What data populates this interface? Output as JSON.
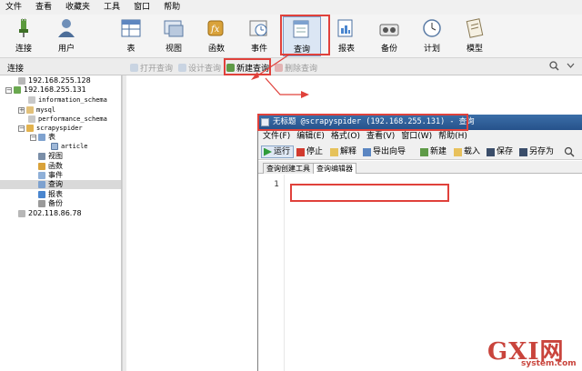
{
  "menubar": [
    "文件",
    "查看",
    "收藏夹",
    "工具",
    "窗口",
    "帮助"
  ],
  "toolbar": [
    {
      "label": "连接",
      "icon": "plug-connection-icon"
    },
    {
      "label": "用户",
      "icon": "user-icon"
    },
    {
      "label": "表",
      "icon": "table-icon"
    },
    {
      "label": "视图",
      "icon": "view-icon"
    },
    {
      "label": "函数",
      "icon": "function-icon"
    },
    {
      "label": "事件",
      "icon": "event-clock-icon"
    },
    {
      "label": "查询",
      "icon": "query-icon"
    },
    {
      "label": "报表",
      "icon": "report-icon"
    },
    {
      "label": "备份",
      "icon": "backup-icon"
    },
    {
      "label": "计划",
      "icon": "schedule-icon"
    },
    {
      "label": "模型",
      "icon": "model-icon"
    }
  ],
  "subbar": {
    "connection_label": "连接",
    "open_query": "打开查询",
    "design_query": "设计查询",
    "new_query": "新建查询",
    "delete_query": "删除查询"
  },
  "tree": [
    {
      "text": "192.168.255.128",
      "icon": "server-icon"
    },
    {
      "text": "192.168.255.131",
      "icon": "server-connected-icon"
    },
    {
      "text": "information_schema",
      "icon": "database-icon"
    },
    {
      "text": "mysql",
      "icon": "database-icon"
    },
    {
      "text": "performance_schema",
      "icon": "database-icon"
    },
    {
      "text": "scrapyspider",
      "icon": "database-open-icon"
    },
    {
      "text": "表",
      "icon": "tables-folder-icon"
    },
    {
      "text": "article",
      "icon": "table-icon"
    },
    {
      "text": "视图",
      "icon": "view-icon"
    },
    {
      "text": "函数",
      "icon": "function-icon"
    },
    {
      "text": "事件",
      "icon": "event-icon"
    },
    {
      "text": "查询",
      "icon": "query-icon"
    },
    {
      "text": "报表",
      "icon": "report-icon"
    },
    {
      "text": "备份",
      "icon": "backup-icon"
    },
    {
      "text": "202.118.86.78",
      "icon": "server-icon"
    }
  ],
  "query_window": {
    "title": "无标题 @scrapyspider (192.168.255.131) - 查询",
    "menu": [
      "文件(F)",
      "编辑(E)",
      "格式(O)",
      "查看(V)",
      "窗口(W)",
      "帮助(H)"
    ],
    "toolbar": {
      "run": "运行",
      "stop": "停止",
      "explain": "解释",
      "export_wizard": "导出向导",
      "new": "新建",
      "load": "载入",
      "save": "保存",
      "save_as": "另存为"
    },
    "tabs": [
      "查询创建工具",
      "查询编辑器"
    ],
    "line_number": "1"
  },
  "watermark": {
    "main": "GXI网",
    "sub": "system.com"
  },
  "colors": {
    "highlight_red": "#e0413b",
    "title_blue": "#2b5a97",
    "watermark_red": "#c9443c"
  }
}
